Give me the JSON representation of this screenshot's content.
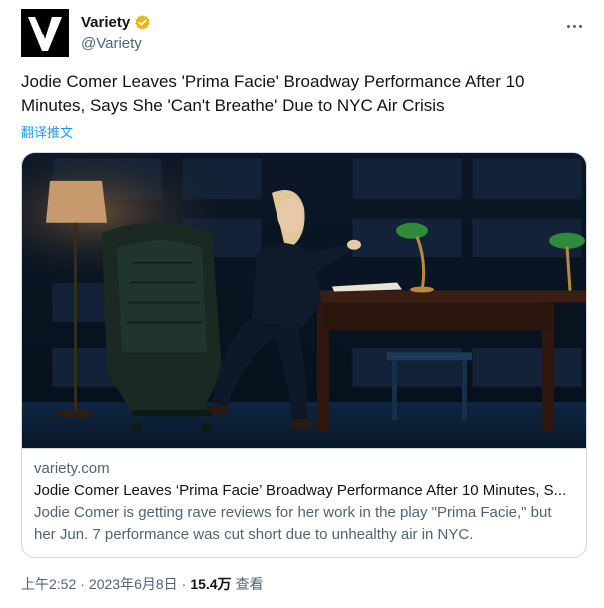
{
  "author": {
    "display_name": "Variety",
    "handle": "@Variety",
    "verified_color": "#e2b719"
  },
  "tweet": {
    "text": "Jodie Comer Leaves 'Prima Facie' Broadway Performance After 10 Minutes, Says She 'Can't Breathe' Due to NYC Air Crisis",
    "translate_label": "翻译推文"
  },
  "card": {
    "domain": "variety.com",
    "title": "Jodie Comer Leaves ‘Prima Facie’ Broadway Performance After 10 Minutes, S...",
    "description": "Jodie Comer is getting rave reviews for her work in the play \"Prima Facie,\" but her Jun. 7 performance was cut short due to unhealthy air in NYC."
  },
  "meta": {
    "time": "上午2:52",
    "separator": "·",
    "date": "2023年6月8日",
    "views_count": "15.4万",
    "views_label": "查看"
  },
  "colors": {
    "accent": "#1d9bf0",
    "secondary_text": "#536471",
    "border": "#cfd9de"
  },
  "icons": {
    "avatar": "variety-logo-icon",
    "verified": "verified-badge-icon",
    "more": "more-options-icon"
  }
}
